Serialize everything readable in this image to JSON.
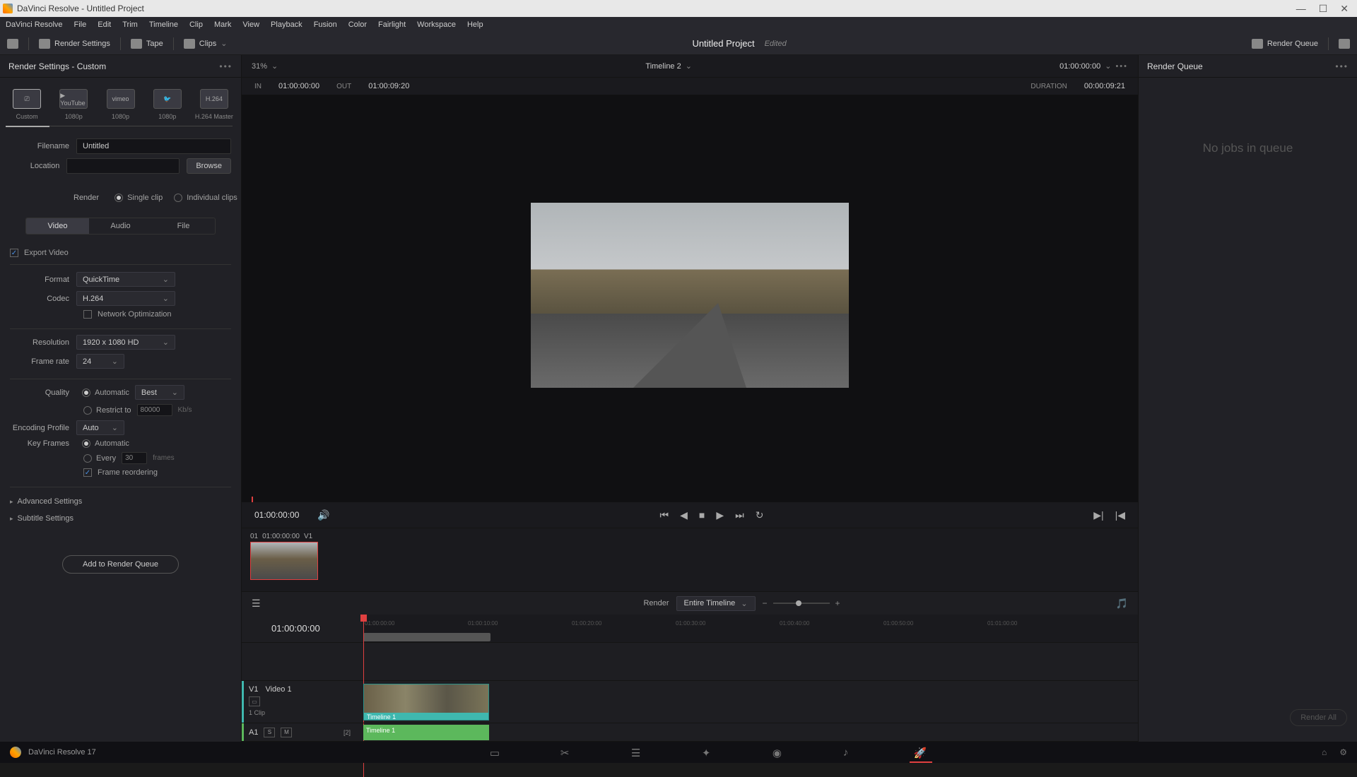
{
  "titlebar": {
    "title": "DaVinci Resolve - Untitled Project"
  },
  "menu": [
    "DaVinci Resolve",
    "File",
    "Edit",
    "Trim",
    "Timeline",
    "Clip",
    "Mark",
    "View",
    "Playback",
    "Fusion",
    "Color",
    "Fairlight",
    "Workspace",
    "Help"
  ],
  "toolbar": {
    "render_settings": "Render Settings",
    "tape": "Tape",
    "clips": "Clips",
    "project": "Untitled Project",
    "edited": "Edited",
    "render_queue": "Render Queue"
  },
  "left": {
    "title": "Render Settings - Custom",
    "presets": [
      {
        "label": "Custom",
        "sub": ""
      },
      {
        "label": "YouTube",
        "sub": "1080p",
        "icon": "▶ YouTube"
      },
      {
        "label": "vimeo",
        "sub": "1080p",
        "icon": "vimeo"
      },
      {
        "label": "",
        "sub": "1080p",
        "icon": "🐦"
      },
      {
        "label": "H.264",
        "sub": "H.264 Master",
        "icon": "H.264"
      }
    ],
    "filename_lbl": "Filename",
    "filename_val": "Untitled",
    "location_lbl": "Location",
    "location_val": "",
    "browse": "Browse",
    "render_lbl": "Render",
    "single": "Single clip",
    "individual": "Individual clips",
    "tabs": [
      "Video",
      "Audio",
      "File"
    ],
    "export_video": "Export Video",
    "format_lbl": "Format",
    "format_val": "QuickTime",
    "codec_lbl": "Codec",
    "codec_val": "H.264",
    "netopt": "Network Optimization",
    "res_lbl": "Resolution",
    "res_val": "1920 x 1080 HD",
    "fr_lbl": "Frame rate",
    "fr_val": "24",
    "quality_lbl": "Quality",
    "auto": "Automatic",
    "best": "Best",
    "restrict": "Restrict to",
    "restrict_val": "80000",
    "kbps": "Kb/s",
    "enc_lbl": "Encoding Profile",
    "enc_val": "Auto",
    "kf_lbl": "Key Frames",
    "every": "Every",
    "every_val": "30",
    "frames": "frames",
    "reorder": "Frame reordering",
    "advanced": "Advanced Settings",
    "subtitle": "Subtitle Settings",
    "add_btn": "Add to Render Queue"
  },
  "viewer": {
    "zoom": "31%",
    "timeline": "Timeline 2",
    "tc": "01:00:00:00",
    "in_lbl": "IN",
    "in_val": "01:00:00:00",
    "out_lbl": "OUT",
    "out_val": "01:00:09:20",
    "dur_lbl": "DURATION",
    "dur_val": "00:00:09:21",
    "current": "01:00:00:00",
    "clip_idx": "01",
    "clip_tc": "01:00:00:00",
    "clip_trk": "V1"
  },
  "timeline": {
    "render_lbl": "Render",
    "render_sel": "Entire Timeline",
    "tc": "01:00:00:00",
    "v1": "V1",
    "v1_name": "Video 1",
    "v1_clips": "1 Clip",
    "a1": "A1",
    "a1_s": "S",
    "a1_m": "M",
    "a1_ch": "[2]",
    "clip_name": "Timeline 1",
    "ticks": [
      "01:00:00:00",
      "01:00:10:00",
      "01:00:20:00",
      "01:00:30:00",
      "01:00:40:00",
      "01:00:50:00",
      "01:01:00:00"
    ]
  },
  "queue": {
    "title": "Render Queue",
    "empty": "No jobs in queue",
    "render_all": "Render All"
  },
  "footer": {
    "version": "DaVinci Resolve 17"
  }
}
